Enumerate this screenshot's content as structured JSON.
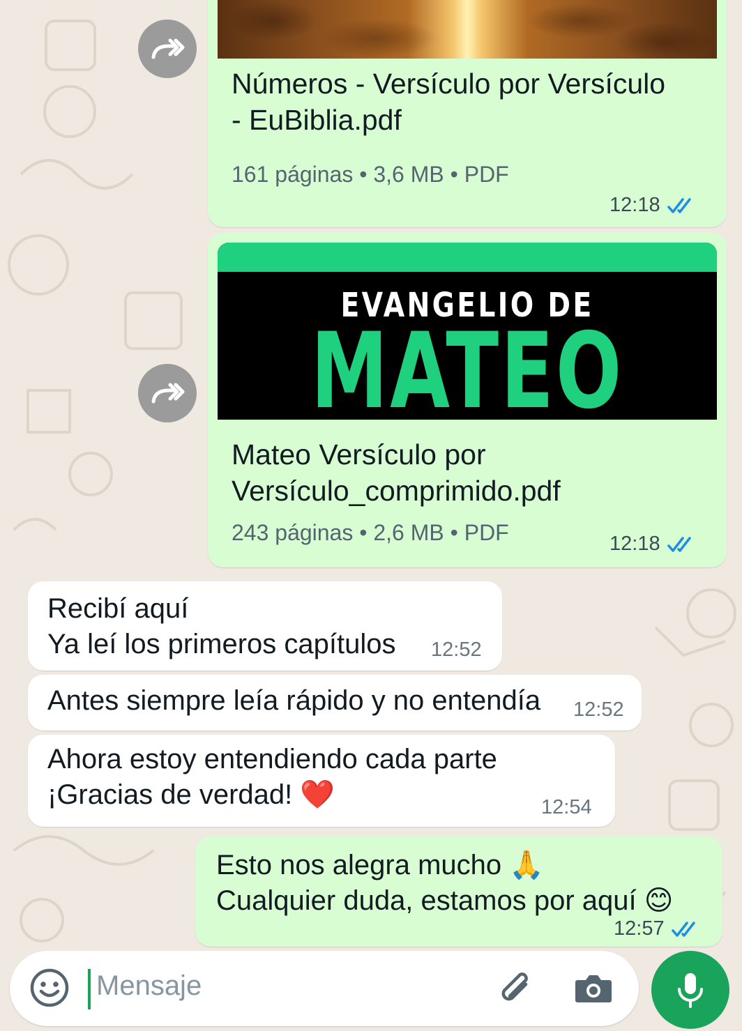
{
  "chat": {
    "doc1": {
      "title_line1": "Números - Versículo por Versículo",
      "title_line2": "- EuBiblia.pdf",
      "meta": "161 páginas • 3,6 MB • PDF",
      "time": "12:18"
    },
    "doc2": {
      "cover_line1": "EVANGELIO DE",
      "cover_line2": "MATEO",
      "title_line1": "Mateo Versículo por",
      "title_line2": "Versículo_comprimido.pdf",
      "meta": "243 páginas • 2,6 MB • PDF",
      "time": "12:18"
    },
    "incoming": [
      {
        "text": "Recibí aquí\nYa leí los primeros capítulos",
        "time": "12:52"
      },
      {
        "text": "Antes siempre leía rápido y no entendía",
        "time": "12:52"
      },
      {
        "text": "Ahora estoy entendiendo cada parte\n¡Gracias de verdad! ❤️",
        "time": "12:54"
      }
    ],
    "outgoing_reply": {
      "text": "Esto nos alegra mucho 🙏\nCualquier duda, estamos por aquí 😊",
      "time": "12:57"
    }
  },
  "composer": {
    "placeholder": "Mensaje"
  },
  "colors": {
    "outgoing_bubble": "#d9fdd3",
    "incoming_bubble": "#ffffff",
    "read_ticks": "#1d8fe1",
    "accent_green": "#1aa35a",
    "cover_green": "#1fd17f"
  },
  "icons": [
    "forward-icon",
    "read-ticks-icon",
    "emoji-icon",
    "attach-icon",
    "camera-icon",
    "mic-icon"
  ]
}
